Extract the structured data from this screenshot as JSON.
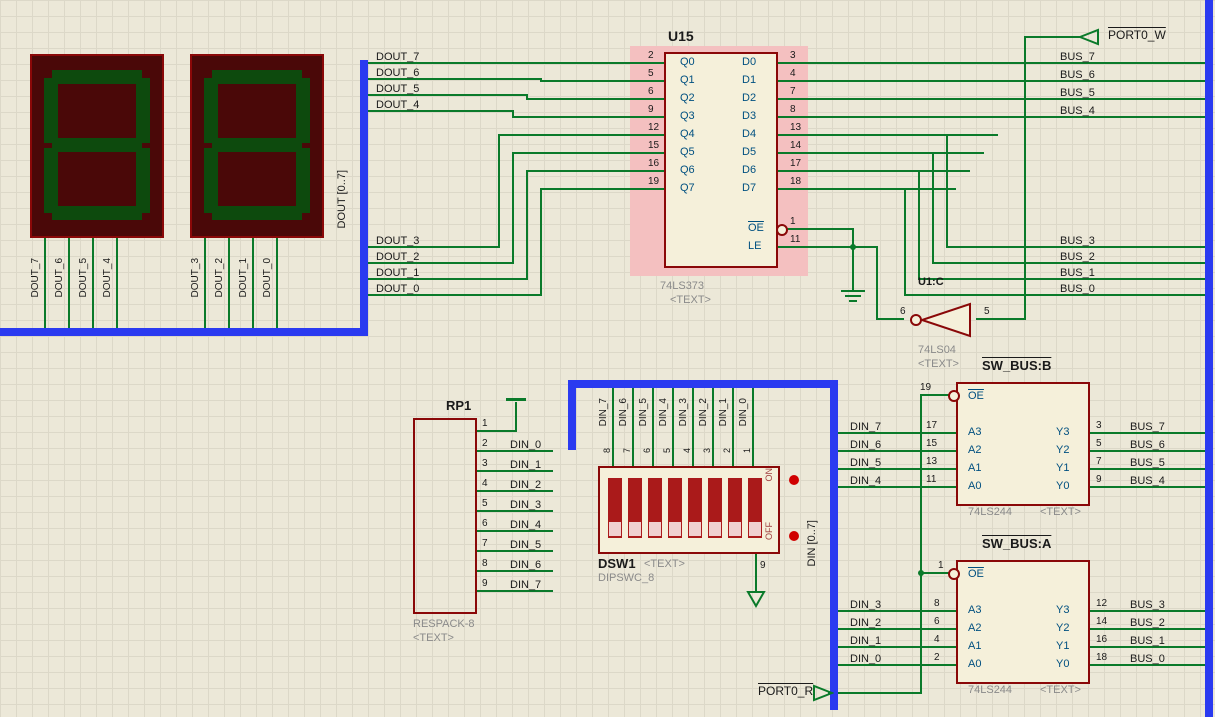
{
  "components": {
    "u15": {
      "ref": "U15",
      "part": "74LS373",
      "text": "<TEXT>",
      "pins_left": [
        {
          "num": "2",
          "name": "Q0",
          "net": "DOUT_7"
        },
        {
          "num": "5",
          "name": "Q1",
          "net": "DOUT_6"
        },
        {
          "num": "6",
          "name": "Q2",
          "net": "DOUT_5"
        },
        {
          "num": "9",
          "name": "Q3",
          "net": "DOUT_4"
        },
        {
          "num": "12",
          "name": "Q4",
          "net": "DOUT_3"
        },
        {
          "num": "15",
          "name": "Q5",
          "net": "DOUT_2"
        },
        {
          "num": "16",
          "name": "Q6",
          "net": "DOUT_1"
        },
        {
          "num": "19",
          "name": "Q7",
          "net": "DOUT_0"
        }
      ],
      "pins_right": [
        {
          "num": "3",
          "name": "D0",
          "net": "BUS_7"
        },
        {
          "num": "4",
          "name": "D1",
          "net": "BUS_6"
        },
        {
          "num": "7",
          "name": "D2",
          "net": "BUS_5"
        },
        {
          "num": "8",
          "name": "D3",
          "net": "BUS_4"
        },
        {
          "num": "13",
          "name": "D4",
          "net": "BUS_3"
        },
        {
          "num": "14",
          "name": "D5",
          "net": "BUS_2"
        },
        {
          "num": "17",
          "name": "D6",
          "net": "BUS_1"
        },
        {
          "num": "18",
          "name": "D7",
          "net": "BUS_0"
        }
      ],
      "pins_ctrl": [
        {
          "num": "1",
          "name": "OE",
          "ov": true
        },
        {
          "num": "11",
          "name": "LE"
        }
      ]
    },
    "u1c": {
      "ref": "U1:C",
      "part": "74LS04",
      "text": "<TEXT>",
      "inpin": "5",
      "outpin": "6"
    },
    "sw_bus_b": {
      "ref": "SW_BUS:B",
      "part": "74LS244",
      "text": "<TEXT>",
      "oe_pin": "19",
      "left": [
        {
          "num": "17",
          "name": "A3",
          "net": "DIN_7"
        },
        {
          "num": "15",
          "name": "A2",
          "net": "DIN_6"
        },
        {
          "num": "13",
          "name": "A1",
          "net": "DIN_5"
        },
        {
          "num": "11",
          "name": "A0",
          "net": "DIN_4"
        }
      ],
      "right": [
        {
          "num": "3",
          "name": "Y3",
          "net": "BUS_7"
        },
        {
          "num": "5",
          "name": "Y2",
          "net": "BUS_6"
        },
        {
          "num": "7",
          "name": "Y1",
          "net": "BUS_5"
        },
        {
          "num": "9",
          "name": "Y0",
          "net": "BUS_4"
        }
      ]
    },
    "sw_bus_a": {
      "ref": "SW_BUS:A",
      "part": "74LS244",
      "text": "<TEXT>",
      "oe_pin": "1",
      "left": [
        {
          "num": "8",
          "name": "A3",
          "net": "DIN_3"
        },
        {
          "num": "6",
          "name": "A2",
          "net": "DIN_2"
        },
        {
          "num": "4",
          "name": "A1",
          "net": "DIN_1"
        },
        {
          "num": "2",
          "name": "A0",
          "net": "DIN_0"
        }
      ],
      "right": [
        {
          "num": "12",
          "name": "Y3",
          "net": "BUS_3"
        },
        {
          "num": "14",
          "name": "Y2",
          "net": "BUS_2"
        },
        {
          "num": "16",
          "name": "Y1",
          "net": "BUS_1"
        },
        {
          "num": "18",
          "name": "Y0",
          "net": "BUS_0"
        }
      ]
    },
    "rp1": {
      "ref": "RP1",
      "part": "RESPACK-8",
      "text": "<TEXT>",
      "pins": [
        {
          "num": "1",
          "name": ""
        },
        {
          "num": "2",
          "name": "DIN_0"
        },
        {
          "num": "3",
          "name": "DIN_1"
        },
        {
          "num": "4",
          "name": "DIN_2"
        },
        {
          "num": "5",
          "name": "DIN_3"
        },
        {
          "num": "6",
          "name": "DIN_4"
        },
        {
          "num": "7",
          "name": "DIN_5"
        },
        {
          "num": "8",
          "name": "DIN_6"
        },
        {
          "num": "9",
          "name": "DIN_7"
        }
      ]
    },
    "dsw1": {
      "ref": "DSW1",
      "part": "DIPSWC_8",
      "text": "<TEXT>",
      "top_nets": [
        "DIN_7",
        "DIN_6",
        "DIN_5",
        "DIN_4",
        "DIN_3",
        "DIN_2",
        "DIN_1",
        "DIN_0"
      ],
      "top_pins": [
        "8",
        "7",
        "6",
        "5",
        "4",
        "3",
        "2",
        "1"
      ],
      "bot_pin": "9",
      "on": "ON",
      "off": "OFF"
    }
  },
  "seven_seg": {
    "left_pins": [
      "DOUT_7",
      "DOUT_6",
      "DOUT_5",
      "DOUT_4"
    ],
    "right_pins": [
      "DOUT_3",
      "DOUT_2",
      "DOUT_1",
      "DOUT_0"
    ]
  },
  "bus_labels": {
    "dout_bus": "DOUT [0..7]",
    "din_bus": "DIN [0..7]",
    "dout_nets": [
      "DOUT_7",
      "DOUT_6",
      "DOUT_5",
      "DOUT_4",
      "DOUT_3",
      "DOUT_2",
      "DOUT_1",
      "DOUT_0"
    ],
    "bus_nets_top": [
      "BUS_7",
      "BUS_6",
      "BUS_5",
      "BUS_4"
    ],
    "bus_nets_mid": [
      "BUS_3",
      "BUS_2",
      "BUS_1",
      "BUS_0"
    ]
  },
  "ports": {
    "port0_w": "PORT0_W",
    "port0_r": "PORT0_R"
  }
}
